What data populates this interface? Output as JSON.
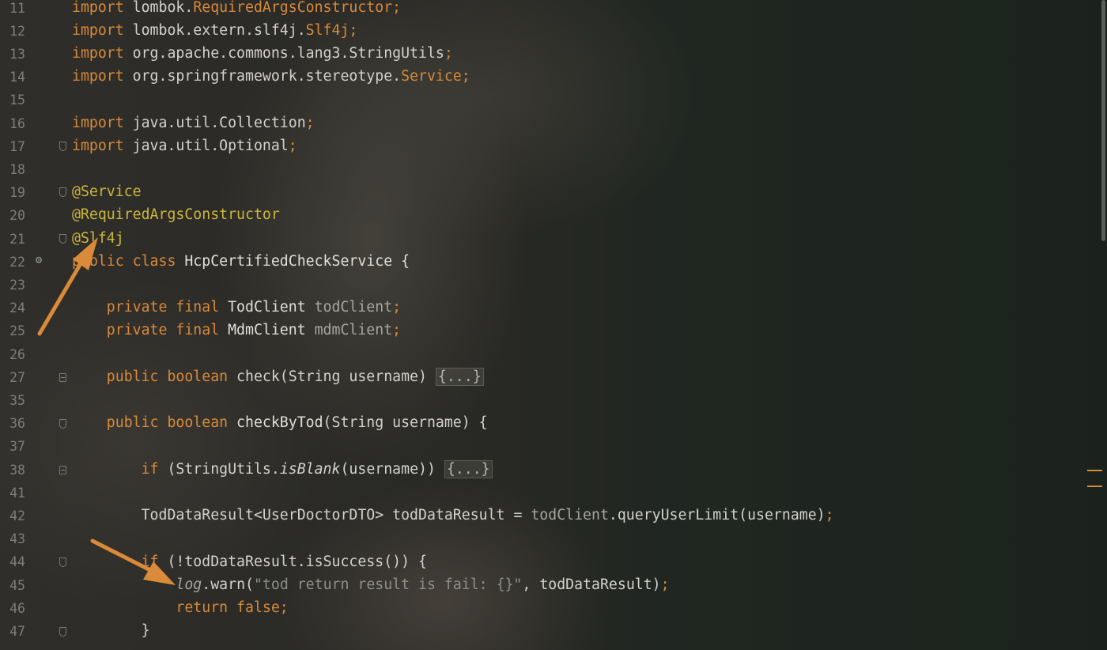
{
  "editor": {
    "accent_color": "#d98a3a",
    "annotation_color": "#cdb63d",
    "line_numbers": [
      "11",
      "12",
      "13",
      "14",
      "15",
      "16",
      "17",
      "18",
      "19",
      "20",
      "21",
      "22",
      "23",
      "24",
      "25",
      "26",
      "27",
      "35",
      "36",
      "37",
      "38",
      "41",
      "42",
      "43",
      "44",
      "45",
      "46",
      "47"
    ],
    "lines": {
      "l11": {
        "a": "import ",
        "b": "lombok.",
        "c": "RequiredArgsConstructor",
        "d": ";"
      },
      "l12": {
        "a": "import ",
        "b": "lombok.extern.slf4j.",
        "c": "Slf4j",
        "d": ";"
      },
      "l13": {
        "a": "import ",
        "b": "org.apache.commons.lang3.StringUtils",
        "d": ";"
      },
      "l14": {
        "a": "import ",
        "b": "org.springframework.stereotype.",
        "c": "Service",
        "d": ";"
      },
      "l16": {
        "a": "import ",
        "b": "java.util.Collection",
        "d": ";"
      },
      "l17": {
        "a": "import ",
        "b": "java.util.Optional",
        "d": ";"
      },
      "l19": {
        "a": "@Service"
      },
      "l20": {
        "a": "@RequiredArgsConstructor"
      },
      "l21": {
        "a": "@Slf4j"
      },
      "l22": {
        "a": "public class ",
        "b": "HcpCertifiedCheckService {"
      },
      "l24": {
        "a": "    private final ",
        "b": "TodClient ",
        "c": "todClient",
        "d": ";"
      },
      "l25": {
        "a": "    private final ",
        "b": "MdmClient ",
        "c": "mdmClient",
        "d": ";"
      },
      "l27": {
        "a": "    public boolean ",
        "b": "check(String username) ",
        "c": "{...}"
      },
      "l36": {
        "a": "    public boolean ",
        "b": "checkByTod",
        "c": "(String username) {"
      },
      "l38": {
        "a": "        if ",
        "b": "(StringUtils.",
        "c": "isBlank",
        "d": "(username)) ",
        "e": "{...}"
      },
      "l42": {
        "a": "        TodDataResult<UserDoctorDTO> todDataResult = ",
        "b": "todClient",
        "c": ".queryUserLimit(username)",
        "d": ";"
      },
      "l44": {
        "a": "        if ",
        "b": "(!todDataResult.isSuccess()) {"
      },
      "l45": {
        "a": "            ",
        "b": "log",
        "c": ".warn(",
        "d": "\"tod return result is fail: {}\"",
        "e": ", todDataResult)",
        "f": ";"
      },
      "l46": {
        "a": "            return false",
        "b": ";"
      },
      "l47": {
        "a": "        }"
      }
    }
  }
}
